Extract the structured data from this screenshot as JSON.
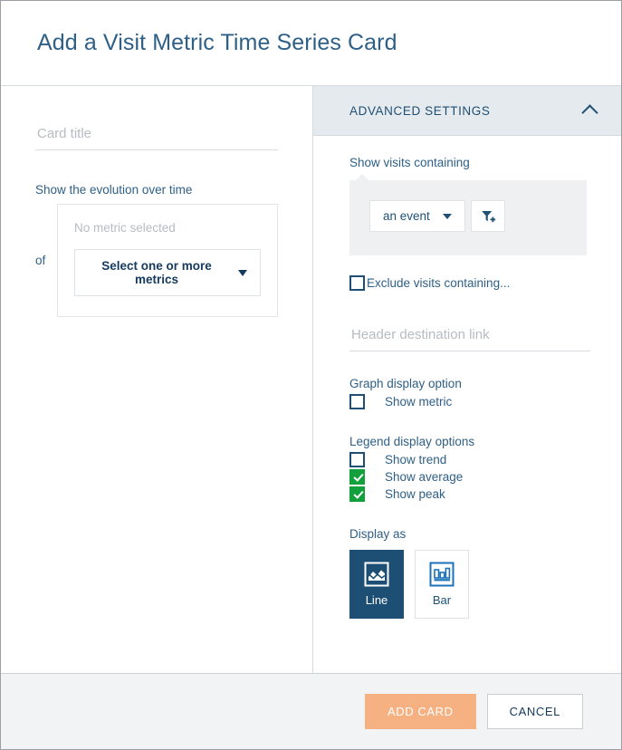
{
  "header": {
    "title": "Add a Visit Metric Time Series Card"
  },
  "left_pane": {
    "card_title_placeholder": "Card title",
    "card_title_value": "",
    "evolution_label": "Show the evolution over time",
    "of_label": "of",
    "metric_empty_text": "No metric selected",
    "select_metrics_label": "Select one or more metrics"
  },
  "advanced_settings": {
    "header_title": "ADVANCED SETTINGS",
    "collapse_icon": "chevron-up-icon",
    "visits_label": "Show visits containing",
    "event_select_value": "an event",
    "add_filter_icon": "filter-add-icon",
    "exclude_label": "Exclude visits containing...",
    "exclude_checked": false,
    "header_link_placeholder": "Header destination link",
    "header_link_value": "",
    "graph_display_title": "Graph display option",
    "show_metric_label": "Show metric",
    "show_metric_checked": false,
    "legend_display_title": "Legend display options",
    "legend_options": [
      {
        "label": "Show trend",
        "checked": false
      },
      {
        "label": "Show average",
        "checked": true
      },
      {
        "label": "Show peak",
        "checked": true
      }
    ],
    "display_as_title": "Display as",
    "display_as_options": [
      {
        "label": "Line",
        "icon": "line-chart-icon",
        "selected": true
      },
      {
        "label": "Bar",
        "icon": "bar-chart-icon",
        "selected": false
      }
    ]
  },
  "footer": {
    "add_card_label": "ADD CARD",
    "cancel_label": "CANCEL"
  },
  "colors": {
    "title_blue": "#2e5f86",
    "accent_navy": "#1d4f75",
    "checkbox_green": "#11a03c",
    "primary_button_orange": "#f6b183",
    "panel_gray": "#eef0f2",
    "header_gray": "#e5eaee",
    "footer_gray": "#f2f3f5"
  }
}
